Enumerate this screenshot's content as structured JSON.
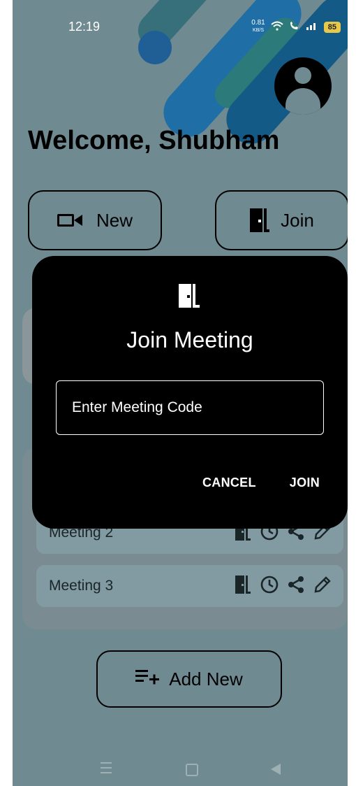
{
  "status_bar": {
    "time": "12:19",
    "net_speed_value": "0.81",
    "net_speed_unit": "KB/S",
    "battery": "85"
  },
  "header": {
    "welcome": "Welcome, Shubham"
  },
  "actions": {
    "new_label": "New",
    "join_label": "Join"
  },
  "meetings": [
    {
      "name": "Meeting 2"
    },
    {
      "name": "Meeting 3"
    }
  ],
  "add_new_label": "Add New",
  "dialog": {
    "title": "Join Meeting",
    "code_placeholder": "Enter Meeting Code",
    "cancel_label": "CANCEL",
    "join_label": "JOIN"
  },
  "colors": {
    "background_dimmed": "#6f8a91",
    "dialog_bg": "#000000",
    "text_light": "#ffffff"
  }
}
